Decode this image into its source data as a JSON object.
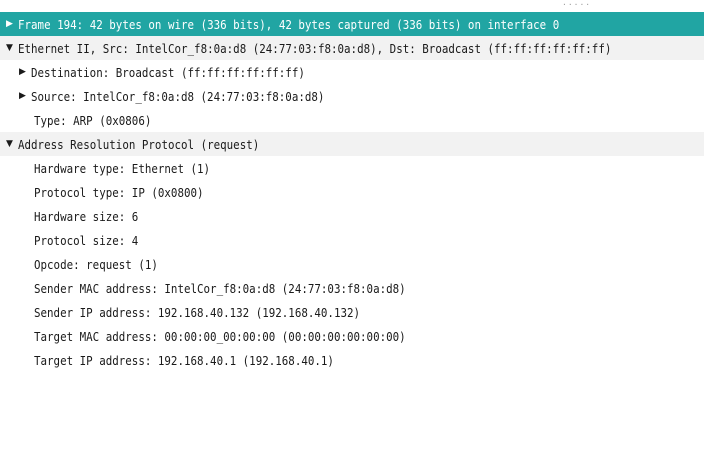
{
  "splitter_dots": ".....",
  "arrows": {
    "collapsed": "▶",
    "expanded": "▼"
  },
  "tree": {
    "frame": "Frame 194: 42 bytes on wire (336 bits), 42 bytes captured (336 bits) on interface 0",
    "ethernet": {
      "label": "Ethernet II, Src: IntelCor_f8:0a:d8 (24:77:03:f8:0a:d8), Dst: Broadcast (ff:ff:ff:ff:ff:ff)",
      "destination": "Destination: Broadcast (ff:ff:ff:ff:ff:ff)",
      "source": "Source: IntelCor_f8:0a:d8 (24:77:03:f8:0a:d8)",
      "type": "Type: ARP (0x0806)"
    },
    "arp": {
      "label": "Address Resolution Protocol (request)",
      "hardware_type": "Hardware type: Ethernet (1)",
      "protocol_type": "Protocol type: IP (0x0800)",
      "hardware_size": "Hardware size: 6",
      "protocol_size": "Protocol size: 4",
      "opcode": "Opcode: request (1)",
      "sender_mac": "Sender MAC address: IntelCor_f8:0a:d8 (24:77:03:f8:0a:d8)",
      "sender_ip": "Sender IP address: 192.168.40.132 (192.168.40.132)",
      "target_mac": "Target MAC address: 00:00:00_00:00:00 (00:00:00:00:00:00)",
      "target_ip": "Target IP address: 192.168.40.1 (192.168.40.1)"
    }
  },
  "colors": {
    "selected_bg": "#21a5a3",
    "group_bg": "#f2f2f2"
  }
}
